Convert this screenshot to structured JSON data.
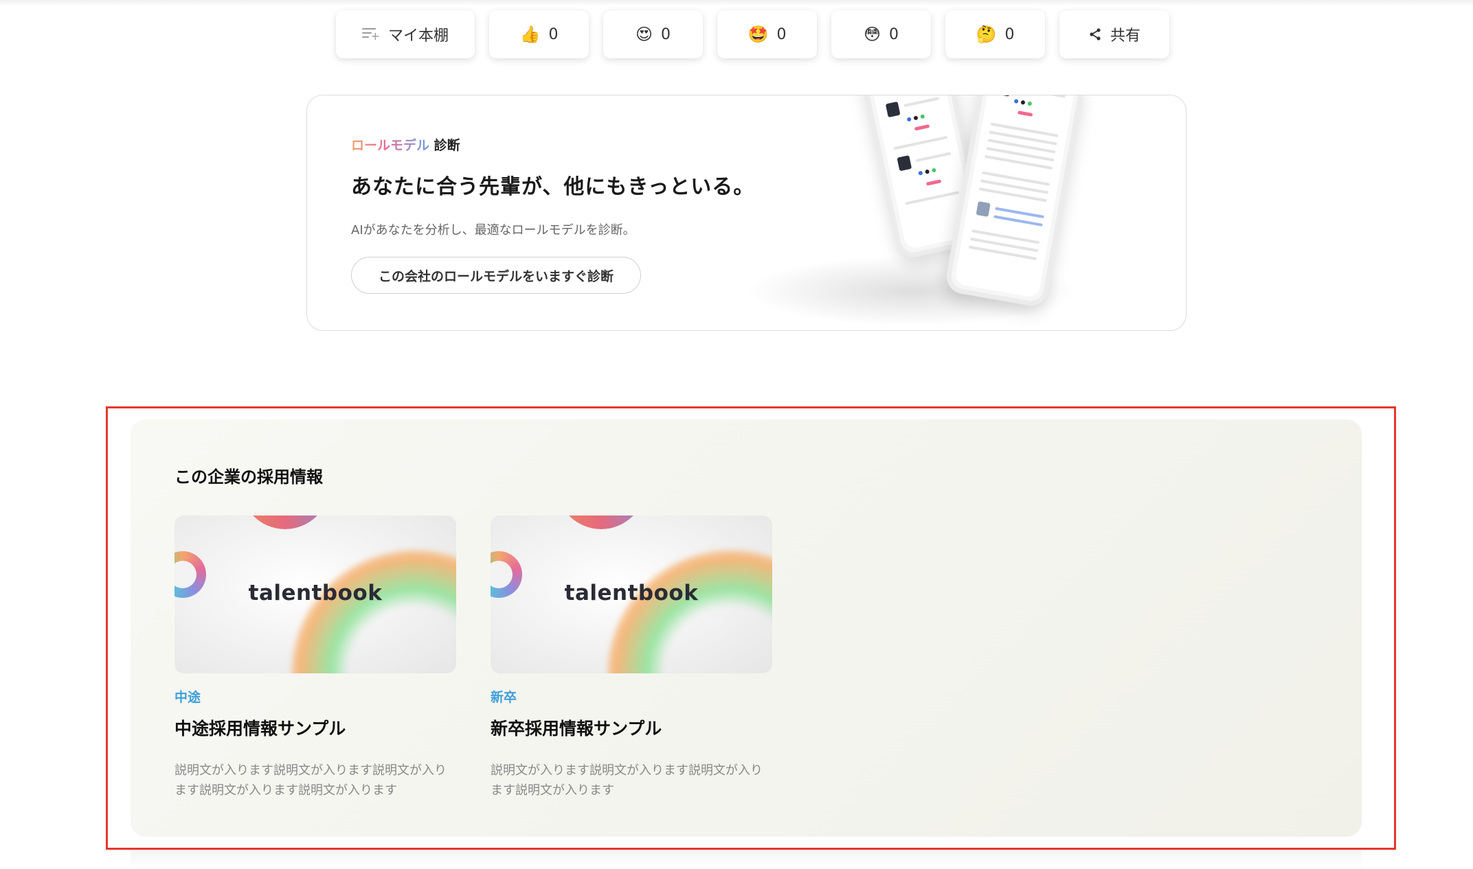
{
  "reactions": {
    "bookshelf_label": "マイ本棚",
    "items": [
      {
        "emoji": "👍",
        "count": "0"
      },
      {
        "emoji": "😍",
        "count": "0"
      },
      {
        "emoji": "🤩",
        "count": "0"
      },
      {
        "emoji": "😳",
        "count": "0"
      },
      {
        "emoji": "🤔",
        "count": "0"
      }
    ],
    "share_label": "共有",
    "share_icon": "share-icon",
    "bookshelf_icon": "add-to-list-icon"
  },
  "rolemodel": {
    "tag_highlight": "ロールモデル",
    "tag_plain": "診断",
    "heading": "あなたに合う先輩が、他にもきっといる。",
    "description": "AIがあなたを分析し、最適なロールモデルを診断。",
    "button_label": "この会社のロールモデルをいますぐ診断"
  },
  "recruit": {
    "heading": "この企業の採用情報",
    "jobs": [
      {
        "brand": "talentbook",
        "tag": "中途",
        "title": "中途採用情報サンプル",
        "description": "説明文が入ります説明文が入ります説明文が入ります説明文が入ります説明文が入ります"
      },
      {
        "brand": "talentbook",
        "tag": "新卒",
        "title": "新卒採用情報サンプル",
        "description": "説明文が入ります説明文が入ります説明文が入ります説明文が入ります"
      }
    ]
  },
  "colors": {
    "highlight_frame": "#e5382a",
    "job_tag": "#3f9fd9",
    "panel_bg": "#f4f4ef"
  }
}
